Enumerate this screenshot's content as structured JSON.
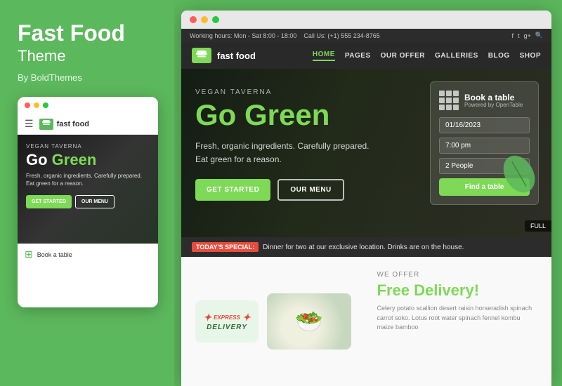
{
  "left": {
    "title": "Fast Food",
    "subtitle": "Theme",
    "by": "By BoldThemes",
    "phone": {
      "dots": [
        "#ff5f57",
        "#febc2e",
        "#28c840"
      ],
      "logo_text": "fast food",
      "vegan_label": "VEGAN TAVERNA",
      "go": "Go ",
      "green": "Green",
      "desc_line1": "Fresh, organic ingredients. Carefully prepared.",
      "desc_line2": "Eat green for a reason.",
      "btn_get": "GET STARTED",
      "btn_menu": "OUR MENU",
      "book_label": "Book a table"
    }
  },
  "browser": {
    "dots": [
      "#ff5f57",
      "#febc2e",
      "#28c840"
    ],
    "topbar": {
      "working_hours": "Working hours: Mon - Sat 8:00 - 18:00",
      "call_us": "Call Us: (+1) 555 234-8765",
      "social": [
        "f",
        "t",
        "g+",
        "🔍"
      ]
    },
    "nav": {
      "logo_text": "fast food",
      "links": [
        "HOME",
        "PAGES",
        "OUR OFFER",
        "GALLERIES",
        "BLOG",
        "SHOP"
      ]
    },
    "hero": {
      "vegan_label": "VEGAN TAVERNA",
      "go": "Go ",
      "green": "Green",
      "desc": "Fresh, organic ingredients. Carefully prepared.\nEat green for a reason.",
      "btn_get": "GET STARTED",
      "btn_menu": "OUR MENU"
    },
    "book_widget": {
      "title": "Book a table",
      "powered": "Powered by OpenTable",
      "date": "01/16/2023",
      "time": "7:00 pm",
      "guests": "2 People",
      "btn": "Find a table"
    },
    "special": {
      "label": "TODAY'S SPECIAL:",
      "text": "Dinner for two at our exclusive location. Drinks are on the house."
    },
    "bottom": {
      "delivery_badge_top": "EXPRESS",
      "delivery_badge_bottom": "DELIVERY",
      "we_offer": "WE OFFER",
      "free_title_free": "Free",
      "free_title_rest": " Delivery!",
      "desc": "Celery potato scallion desert raisin horseradish spinach carrot soko. Lotus root water spinach fennel kombu maize bamboo"
    },
    "full_label": "FULL"
  }
}
